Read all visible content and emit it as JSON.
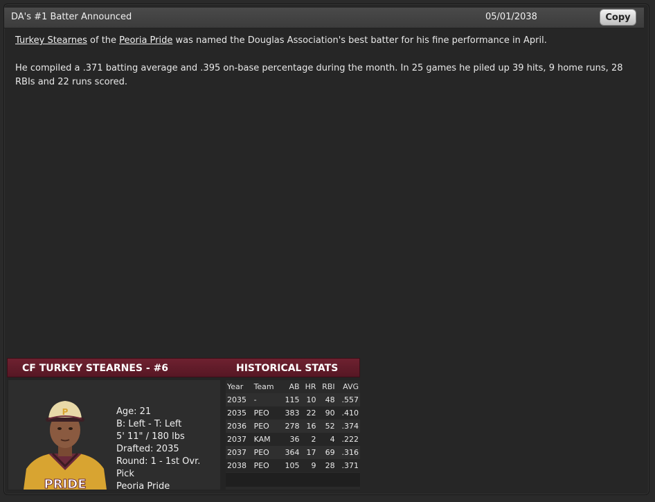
{
  "header": {
    "title": "DA's #1 Batter Announced",
    "date": "05/01/2038",
    "copy_label": "Copy"
  },
  "article": {
    "player_link": "Turkey Stearnes",
    "of_the": "of the",
    "team_link": "Peoria Pride",
    "sentence1_rest": "was named the Douglas Association's best batter for his fine performance in April.",
    "paragraph2": "He compiled a .371 batting average and .395 on-base percentage during the month. In 25 games he piled up 39 hits, 9 home runs, 28 RBIs and 22 runs scored."
  },
  "card": {
    "name_header": "CF TURKEY STEARNES - #6",
    "hist_header": "HISTORICAL STATS",
    "info": {
      "age": "Age: 21",
      "bats_throws": "B: Left - T: Left",
      "height_weight": "5' 11\" / 180 lbs",
      "drafted": "Drafted: 2035",
      "round": "Round: 1 - 1st Ovr. Pick",
      "team": "Peoria Pride"
    },
    "photo_icon": "player-photo",
    "cap_letter": "P",
    "jersey_text": "PRIDE",
    "stats": {
      "headers": [
        "Year",
        "Team",
        "AB",
        "HR",
        "RBI",
        "AVG"
      ],
      "rows": [
        [
          "2035",
          "-",
          "115",
          "10",
          "48",
          ".557"
        ],
        [
          "2035",
          "PEO",
          "383",
          "22",
          "90",
          ".410"
        ],
        [
          "2036",
          "PEO",
          "278",
          "16",
          "52",
          ".374"
        ],
        [
          "2037",
          "KAM",
          "36",
          "2",
          "4",
          ".222"
        ],
        [
          "2037",
          "PEO",
          "364",
          "17",
          "69",
          ".316"
        ],
        [
          "2038",
          "PEO",
          "105",
          "9",
          "28",
          ".371"
        ]
      ]
    }
  }
}
